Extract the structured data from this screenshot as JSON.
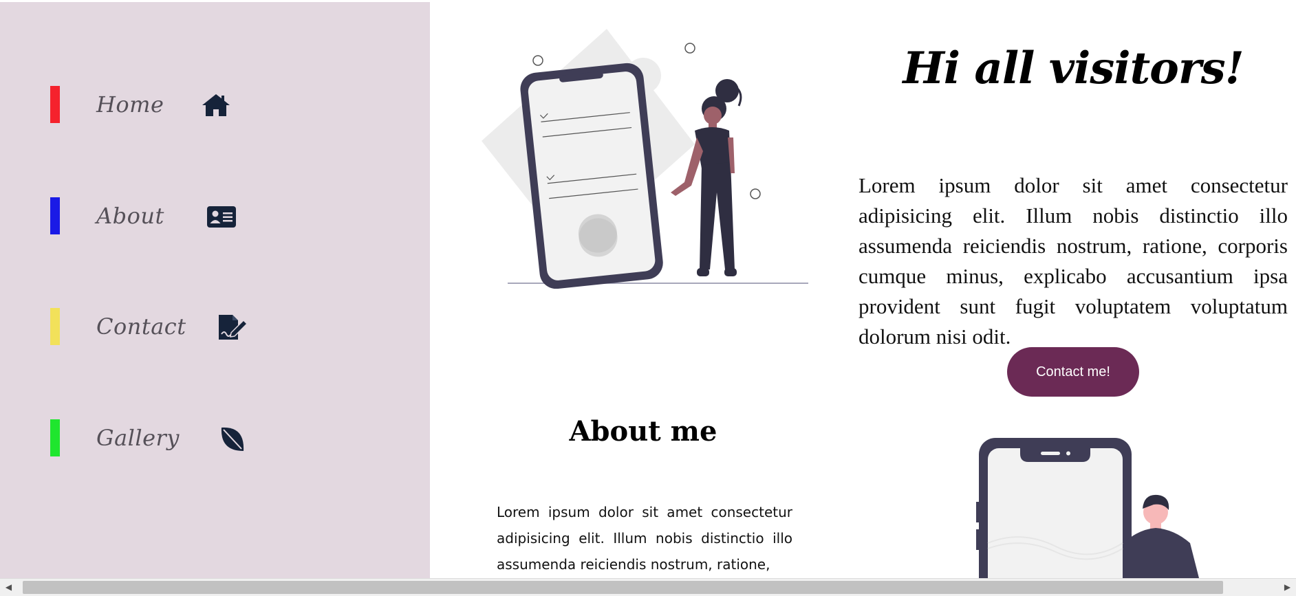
{
  "sidebar": {
    "items": [
      {
        "label": "Home",
        "bar_color": "#f5222d",
        "icon": "home-icon"
      },
      {
        "label": "About",
        "bar_color": "#1a1ae6",
        "icon": "id-card-icon"
      },
      {
        "label": "Contact",
        "bar_color": "#f2e15a",
        "icon": "signature-icon"
      },
      {
        "label": "Gallery",
        "bar_color": "#1fe62e",
        "icon": "leaf-icon"
      }
    ],
    "background": "#e3d8e0",
    "icon_color": "#16233a"
  },
  "hero": {
    "title": "Hi all visitors!",
    "text": "Lorem ipsum dolor sit amet consectetur adipisicing elit. Illum nobis distinctio illo assumenda reiciendis nostrum, ratione, corporis cumque minus, explicabo accusantium ipsa provident sunt fugit voluptatem voluptatum dolorum nisi odit.",
    "button_label": "Contact me!",
    "button_color": "#6b2a55"
  },
  "about": {
    "title": "About me",
    "text": "Lorem ipsum dolor sit amet consectetur adipisicing elit. Illum nobis distinctio illo assumenda reiciendis nostrum, ratione,"
  },
  "scrollbar": {
    "left_arrow": "◀",
    "right_arrow": "▶"
  }
}
